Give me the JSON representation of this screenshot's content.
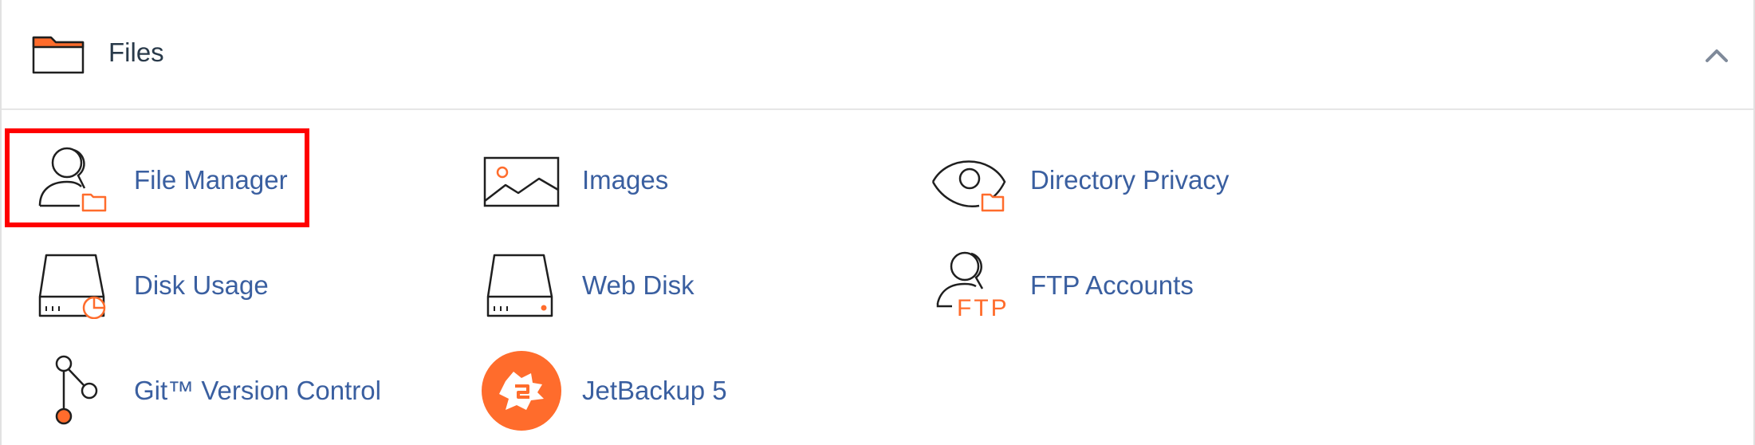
{
  "section": {
    "title": "Files",
    "folder_icon": "folder-icon",
    "collapse_icon": "chevron-up-icon"
  },
  "colors": {
    "accent": "#ff6c2c",
    "link": "#3a5fa0",
    "highlight": "#ff0000"
  },
  "items": [
    {
      "label": "File Manager",
      "icon": "file-manager-icon",
      "highlighted": true
    },
    {
      "label": "Images",
      "icon": "image-icon"
    },
    {
      "label": "Directory Privacy",
      "icon": "eye-folder-icon"
    },
    {
      "label": "Disk Usage",
      "icon": "disk-usage-icon"
    },
    {
      "label": "Web Disk",
      "icon": "web-disk-icon"
    },
    {
      "label": "FTP Accounts",
      "icon": "ftp-accounts-icon"
    },
    {
      "label": "Git™ Version Control",
      "icon": "git-branch-icon"
    },
    {
      "label": "JetBackup 5",
      "icon": "jetbackup-logo-icon"
    }
  ]
}
